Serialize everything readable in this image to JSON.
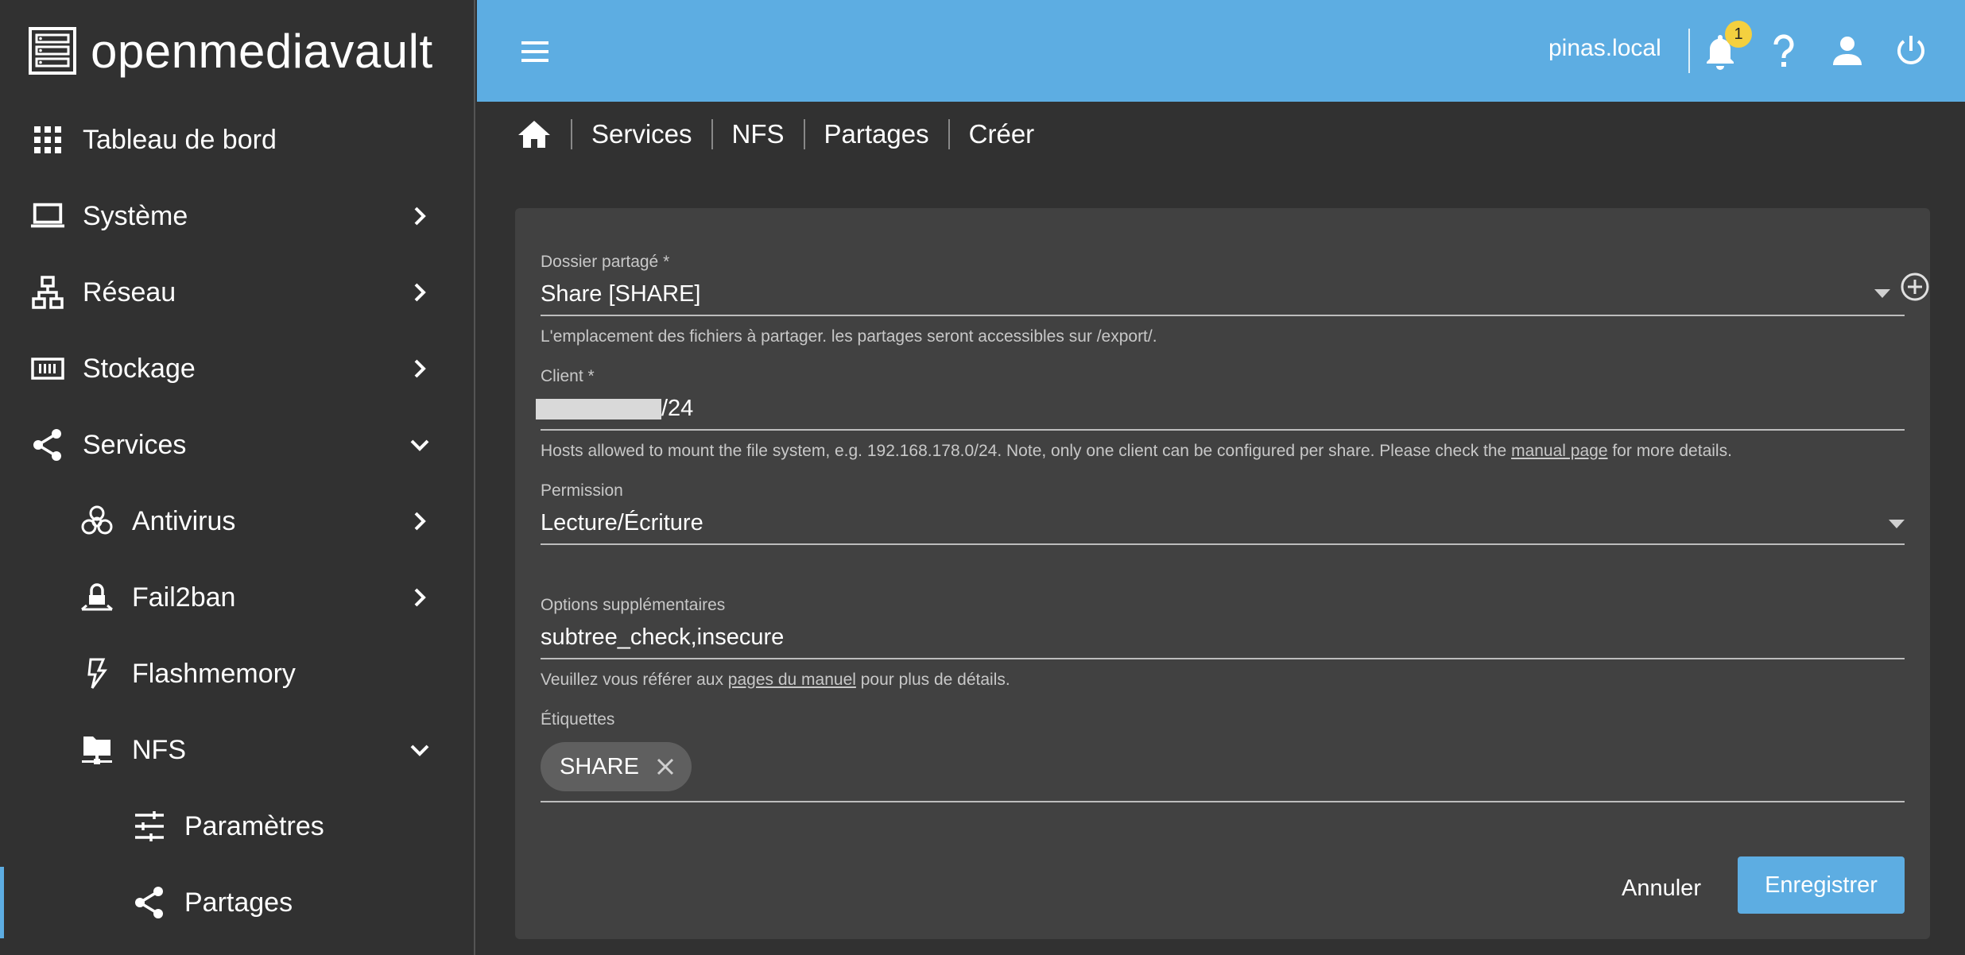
{
  "app": {
    "name": "openmediavault"
  },
  "sidebar": {
    "items": [
      {
        "label": "Tableau de bord",
        "icon": "dashboard-grid-icon"
      },
      {
        "label": "Système",
        "icon": "laptop-icon"
      },
      {
        "label": "Réseau",
        "icon": "network-icon"
      },
      {
        "label": "Stockage",
        "icon": "storage-icon"
      },
      {
        "label": "Services",
        "icon": "share-icon"
      },
      {
        "label": "Antivirus",
        "icon": "biohazard-icon"
      },
      {
        "label": "Fail2ban",
        "icon": "lock-icon"
      },
      {
        "label": "Flashmemory",
        "icon": "flash-icon"
      },
      {
        "label": "NFS",
        "icon": "folder-network-icon"
      },
      {
        "label": "Paramètres",
        "icon": "tune-icon"
      },
      {
        "label": "Partages",
        "icon": "share-icon"
      }
    ]
  },
  "topbar": {
    "hostname": "pinas.local",
    "notification_count": "1"
  },
  "breadcrumb": [
    "Services",
    "NFS",
    "Partages",
    "Créer"
  ],
  "form": {
    "shared_folder": {
      "label": "Dossier partagé *",
      "value": "Share [SHARE]",
      "hint": "L'emplacement des fichiers à partager. les partages seront accessibles sur /export/."
    },
    "client": {
      "label": "Client *",
      "value": "/24",
      "hint_pre": "Hosts allowed to mount the file system, e.g. 192.168.178.0/24. Note, only one client can be configured per share. Please check the ",
      "hint_link": "manual page",
      "hint_post": " for more details."
    },
    "permission": {
      "label": "Permission",
      "value": "Lecture/Écriture"
    },
    "extra_options": {
      "label": "Options supplémentaires",
      "value": "subtree_check,insecure",
      "hint_pre": "Veuillez vous référer aux ",
      "hint_link": "pages du manuel",
      "hint_post": " pour plus de détails."
    },
    "tags": {
      "label": "Étiquettes",
      "chips": [
        "SHARE"
      ]
    },
    "cancel_label": "Annuler",
    "save_label": "Enregistrer"
  },
  "colors": {
    "accent": "#5dade2",
    "background": "#313131",
    "card": "#414141",
    "badge": "#f4d03f"
  }
}
